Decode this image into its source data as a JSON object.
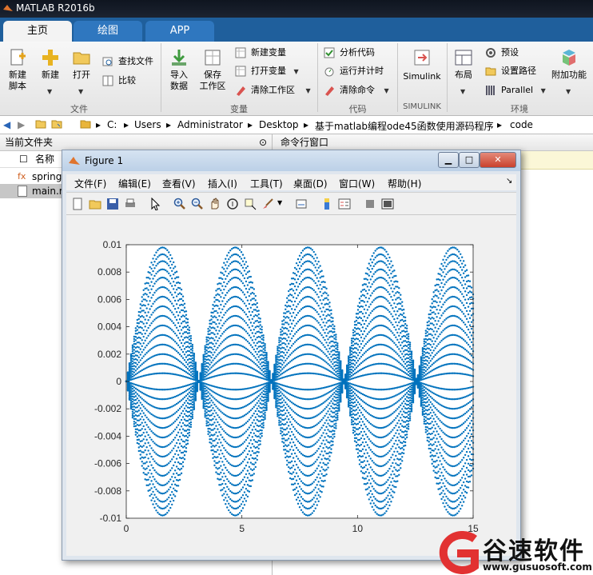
{
  "app": {
    "title": "MATLAB R2016b"
  },
  "tabs": [
    {
      "label": "主页"
    },
    {
      "label": "绘图"
    },
    {
      "label": "APP"
    }
  ],
  "ribbon": {
    "file": {
      "new_script": "新建\n脚本",
      "new_script_l1": "新建",
      "new_script_l2": "脚本",
      "new": "新建",
      "open": "打开",
      "find_files": "查找文件",
      "compare": "比较",
      "group": "文件"
    },
    "variable": {
      "import_l1": "导入",
      "import_l2": "数据",
      "save_l1": "保存",
      "save_l2": "工作区",
      "new_variable": "新建变量",
      "open_variable": "打开变量",
      "clear_workspace": "清除工作区",
      "group": "变量"
    },
    "code": {
      "analyze": "分析代码",
      "run_time": "运行并计时",
      "clear_commands": "清除命令",
      "group": "代码"
    },
    "simulink": {
      "label": "Simulink",
      "group": "SIMULINK"
    },
    "environment": {
      "layout": "布局",
      "preferences": "预设",
      "set_path": "设置路径",
      "parallel": "Parallel",
      "addons": "附加功能",
      "group": "环境"
    }
  },
  "address": {
    "path": [
      "C:",
      "Users",
      "Administrator",
      "Desktop",
      "基于matlab编程ode45函数使用源码程序",
      "code"
    ]
  },
  "current_folder": {
    "header": "当前文件夹",
    "column_name": "名称",
    "files": [
      {
        "name": "spring"
      },
      {
        "name": "main.m"
      }
    ]
  },
  "command_window": {
    "header": "命令行窗口"
  },
  "figure": {
    "title": "Figure 1",
    "menu": [
      "文件(F)",
      "编辑(E)",
      "查看(V)",
      "插入(I)",
      "工具(T)",
      "桌面(D)",
      "窗口(W)",
      "帮助(H)"
    ]
  },
  "watermark": {
    "brand": "谷速软件",
    "url": "www.gusuosoft.com"
  },
  "chart_data": {
    "type": "scatter",
    "title": "",
    "xlabel": "",
    "ylabel": "",
    "xlim": [
      0,
      15
    ],
    "ylim": [
      -0.01,
      0.01
    ],
    "xticks": [
      0,
      5,
      10,
      15
    ],
    "xtick_labels": [
      "0",
      "5",
      "10",
      "15"
    ],
    "yticks": [
      -0.01,
      -0.008,
      -0.006,
      -0.004,
      -0.002,
      0,
      0.002,
      0.004,
      0.006,
      0.008,
      0.01
    ],
    "ytick_labels": [
      "-0.01",
      "-0.008",
      "-0.006",
      "-0.004",
      "-0.002",
      "0",
      "0.002",
      "0.004",
      "0.006",
      "0.008",
      "0.01"
    ],
    "grid": false,
    "marker_color": "#0072BD",
    "function": "y = A * sin(x)",
    "amplitudes": [
      0.0098,
      0.0093,
      0.0088,
      0.0082,
      0.0076,
      0.0069,
      0.0062,
      0.0055,
      0.0048,
      0.0041,
      0.0034,
      0.0027,
      0.002,
      0.0013,
      0.0006,
      -0.0006,
      -0.0013,
      -0.002,
      -0.0027,
      -0.0034,
      -0.0041,
      -0.0048,
      -0.0055,
      -0.0062,
      -0.0069,
      -0.0076,
      -0.0082,
      -0.0088,
      -0.0093,
      -0.0098
    ],
    "points_per_curve": 220
  }
}
